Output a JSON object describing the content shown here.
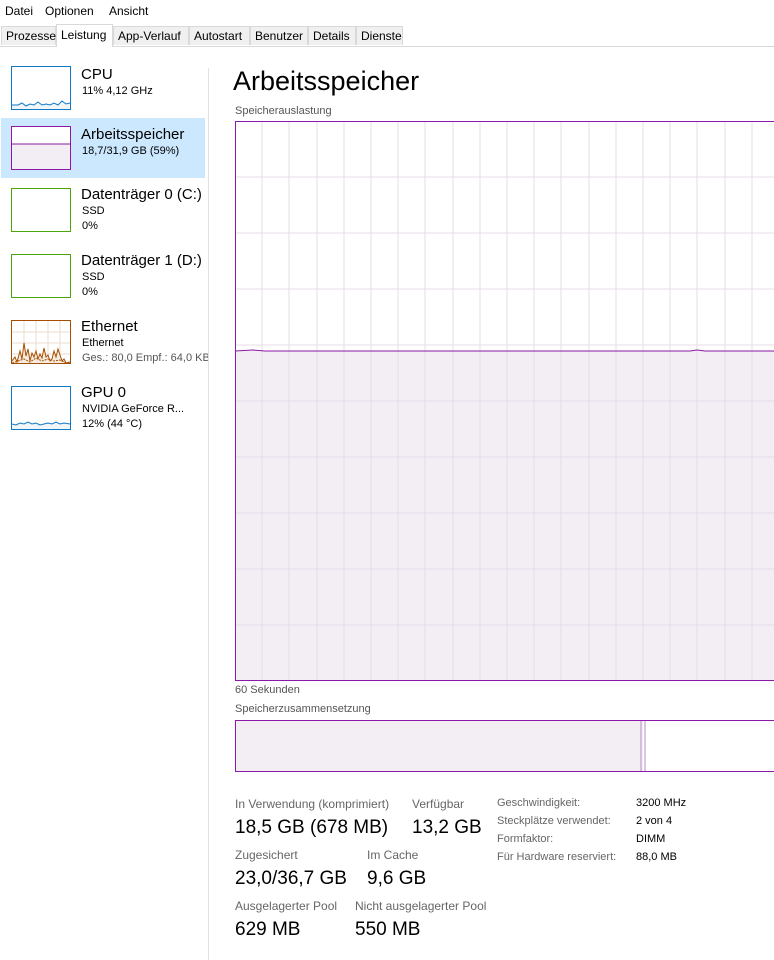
{
  "menu": {
    "items": [
      "Datei",
      "Optionen",
      "Ansicht"
    ]
  },
  "tabs": [
    "Prozesse",
    "Leistung",
    "App-Verlauf",
    "Autostart",
    "Benutzer",
    "Details",
    "Dienste"
  ],
  "active_tab": "Leistung",
  "sidebar": {
    "items": [
      {
        "title": "CPU",
        "line1": "11% 4,12 GHz",
        "line2": "",
        "color": "#1179c4"
      },
      {
        "title": "Arbeitsspeicher",
        "line1": "18,7/31,9 GB (59%)",
        "line2": "",
        "color": "#8b18a6"
      },
      {
        "title": "Datenträger 0 (C:)",
        "line1": "SSD",
        "line2": "0%",
        "color": "#4da50e"
      },
      {
        "title": "Datenträger 1 (D:)",
        "line1": "SSD",
        "line2": "0%",
        "color": "#4da50e"
      },
      {
        "title": "Ethernet",
        "line1": "Ethernet",
        "line2": "Ges.: 80,0  Empf.: 64,0 KB",
        "color": "#a74f01"
      },
      {
        "title": "GPU 0",
        "line1": "NVIDIA GeForce R...",
        "line2": "12% (44 °C)",
        "color": "#1179c4"
      }
    ]
  },
  "main": {
    "title": "Arbeitsspeicher",
    "graph_label": "Speicherauslastung",
    "time_label": "60 Sekunden",
    "usage_fraction": 0.59,
    "composition_label": "Speicherzusammensetzung",
    "composition_in_use_fraction": 0.755,
    "accent_color": "#8b18a6",
    "fill_color": "#f2eef4"
  },
  "stats": {
    "in_use_label": "In Verwendung (komprimiert)",
    "in_use_value": "18,5 GB (678 MB)",
    "available_label": "Verfügbar",
    "available_value": "13,2 GB",
    "committed_label": "Zugesichert",
    "committed_value": "23,0/36,7 GB",
    "cached_label": "Im Cache",
    "cached_value": "9,6 GB",
    "paged_label": "Ausgelagerter Pool",
    "paged_value": "629 MB",
    "nonpaged_label": "Nicht ausgelagerter Pool",
    "nonpaged_value": "550 MB"
  },
  "details": [
    {
      "label": "Geschwindigkeit:",
      "value": "3200 MHz"
    },
    {
      "label": "Steckplätze verwendet:",
      "value": "2 von 4"
    },
    {
      "label": "Formfaktor:",
      "value": "DIMM"
    },
    {
      "label": "Für Hardware reserviert:",
      "value": "88,0 MB"
    }
  ]
}
